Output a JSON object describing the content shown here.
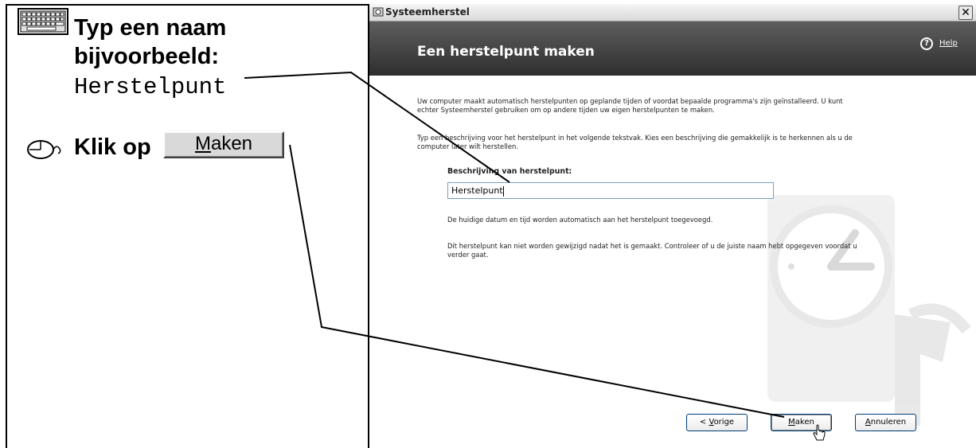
{
  "instructions": {
    "step1": {
      "icon": "keyboard-icon",
      "line1": "Typ een naam",
      "line2": "bijvoorbeeld:",
      "example": "Herstelpunt"
    },
    "step2": {
      "icon": "mouse-icon",
      "text": "Klik op",
      "button_prefix": "",
      "button_mnemonic": "M",
      "button_rest": "aken"
    }
  },
  "window": {
    "title": "Systeemherstel",
    "close_label": "✕",
    "header_title": "Een herstelpunt maken",
    "help_label": "Help",
    "paragraph1": "Uw computer maakt automatisch herstelpunten op geplande tijden of voordat bepaalde programma's zijn geïnstalleerd. U kunt echter Systeemherstel gebruiken om op andere tijden uw eigen herstelpunten te maken.",
    "paragraph2": "Typ een beschrijving voor het herstelpunt in het volgende tekstvak. Kies een beschrijving die gemakkelijk is te herkennen als u de computer later wilt herstellen.",
    "field_label": "Beschrijving van herstelpunt:",
    "field_value": "Herstelpunt",
    "paragraph3": "De huidige datum en tijd worden automatisch aan het herstelpunt toegevoegd.",
    "paragraph4": "Dit herstelpunt kan niet worden gewijzigd nadat het is gemaakt. Controleer of u de juiste naam hebt opgegeven voordat u verder gaat.",
    "buttons": {
      "prev": {
        "before": "< ",
        "mnemonic": "V",
        "after": "orige"
      },
      "make": {
        "before": "",
        "mnemonic": "M",
        "after": "aken"
      },
      "cancel": {
        "before": "",
        "mnemonic": "A",
        "after": "nnuleren"
      }
    }
  },
  "colors": {
    "header_dark": "#2e2e2e",
    "header_light": "#5e5e5e",
    "input_border": "#7f9db9",
    "button_border": "#003c74"
  }
}
